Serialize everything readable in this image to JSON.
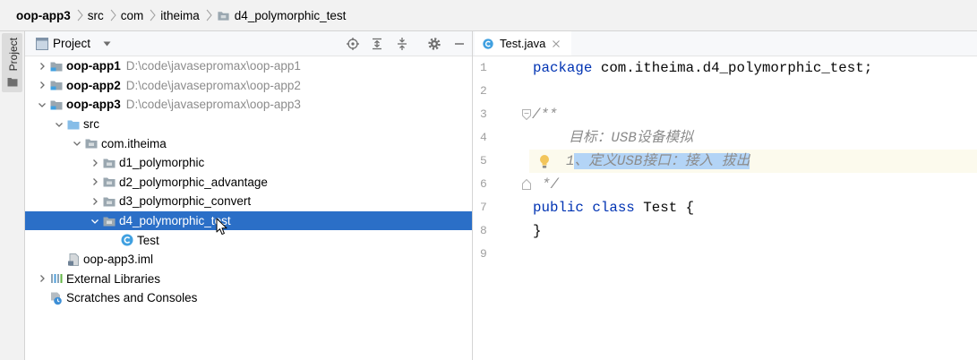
{
  "colors": {
    "keyword": "#0033b3",
    "comment": "#8c8c8c",
    "selection": "#b3d4f6",
    "current_line": "#fcfaed",
    "tree_selection": "#2b6fc7"
  },
  "breadcrumb": {
    "items": [
      {
        "label": "oop-app3"
      },
      {
        "label": "src"
      },
      {
        "label": "com"
      },
      {
        "label": "itheima"
      },
      {
        "label": "d4_polymorphic_test",
        "icon": "package-folder-icon"
      }
    ]
  },
  "tool_strip": {
    "project_label": "Project",
    "icon": "folder-icon"
  },
  "project_panel": {
    "title": "Project",
    "toolbar_icons": [
      "locate-icon",
      "expand-all-icon",
      "collapse-all-icon",
      "gear-icon",
      "hide-icon"
    ],
    "tree": [
      {
        "label": "oop-app1",
        "path": "D:\\code\\javasepromax\\oop-app1",
        "icon": "module-folder-icon",
        "expanded": false
      },
      {
        "label": "oop-app2",
        "path": "D:\\code\\javasepromax\\oop-app2",
        "icon": "module-folder-icon",
        "expanded": false
      },
      {
        "label": "oop-app3",
        "path": "D:\\code\\javasepromax\\oop-app3",
        "icon": "module-folder-icon",
        "expanded": true
      },
      {
        "label": "src",
        "icon": "source-folder-icon",
        "expanded": true
      },
      {
        "label": "com.itheima",
        "icon": "package-folder-icon",
        "expanded": true
      },
      {
        "label": "d1_polymorphic",
        "icon": "package-folder-icon",
        "expanded": false
      },
      {
        "label": "d2_polymorphic_advantage",
        "icon": "package-folder-icon",
        "expanded": false
      },
      {
        "label": "d3_polymorphic_convert",
        "icon": "package-folder-icon",
        "expanded": false
      },
      {
        "label": "d4_polymorphic_test",
        "icon": "package-folder-icon",
        "expanded": true,
        "selected": true
      },
      {
        "label": "Test",
        "icon": "java-class-icon"
      },
      {
        "label": "oop-app3.iml",
        "icon": "module-file-icon"
      },
      {
        "label": "External Libraries",
        "icon": "library-icon",
        "expanded": false
      },
      {
        "label": "Scratches and Consoles",
        "icon": "scratches-icon"
      }
    ]
  },
  "editor": {
    "tab": {
      "label": "Test.java",
      "icon": "java-class-icon"
    },
    "line_numbers": [
      "1",
      "2",
      "3",
      "4",
      "5",
      "6",
      "7",
      "8",
      "9"
    ],
    "code": {
      "l1": {
        "keyword": "package",
        "text": "com.itheima.d4_polymorphic_test;"
      },
      "l3": {
        "comment": "/**"
      },
      "l4": {
        "comment": "目标：USB设备模拟"
      },
      "l5": {
        "number": "1",
        "selected_text": "、定义USB接口：接入 拔出"
      },
      "l6": {
        "comment": "*/"
      },
      "l7": {
        "keyword1": "public",
        "keyword2": "class",
        "name": "Test",
        "brace": "{"
      },
      "l8": {
        "brace": "}"
      }
    }
  }
}
